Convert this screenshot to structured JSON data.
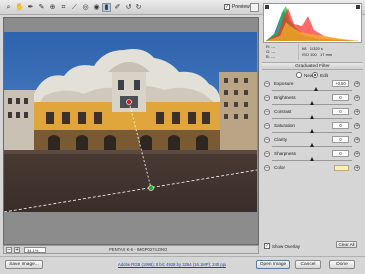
{
  "toolbar": {
    "preview_label": "Preview",
    "preview_checked": true,
    "tools": [
      "zoom-tool",
      "hand-tool",
      "white-balance-tool",
      "color-sampler-tool",
      "targeted-adjustment-tool",
      "crop-tool",
      "straighten-tool",
      "spot-removal-tool",
      "red-eye-tool",
      "adjustment-brush",
      "graduated-filter",
      "preferences",
      "rotate-left",
      "rotate-right"
    ]
  },
  "readout": {
    "r": "R:",
    "g": "G:",
    "b": "B:",
    "r_val": "---",
    "g_val": "---",
    "b_val": "---",
    "aperture": "f/8",
    "shutter": "1/320 s",
    "iso": "ISO 100",
    "focal": "17 mm"
  },
  "panel": {
    "title": "Graduated Filter",
    "mode_new": "New",
    "mode_edit": "Edit",
    "selected_mode": "Edit",
    "sliders": [
      {
        "label": "Exposure",
        "value": "+0.50",
        "level": 0.56
      },
      {
        "label": "Brightness",
        "value": "0",
        "level": 0.5
      },
      {
        "label": "Contrast",
        "value": "0",
        "level": 0.5
      },
      {
        "label": "Saturation",
        "value": "0",
        "level": 0.5
      },
      {
        "label": "Clarity",
        "value": "0",
        "level": 0.5
      },
      {
        "label": "Sharpness",
        "value": "0",
        "level": 0.5
      }
    ],
    "color_label": "Color",
    "color_swatch": "#f9eeb7",
    "show_overlay_label": "Show Overlay",
    "show_overlay_checked": true,
    "clear_all_label": "Clear All"
  },
  "status": {
    "zoom": "34.1%",
    "filename": "PENTAX K-5 - IMGP0274.DNG"
  },
  "footer": {
    "save_image_label": "Save Image...",
    "workflow_link": "Adobe RGB (1998); 8 bit; 4928 by 3264 (16.1MP); 240 ppi",
    "open_image_label": "Open Image",
    "cancel_label": "Cancel",
    "done_label": "Done"
  }
}
